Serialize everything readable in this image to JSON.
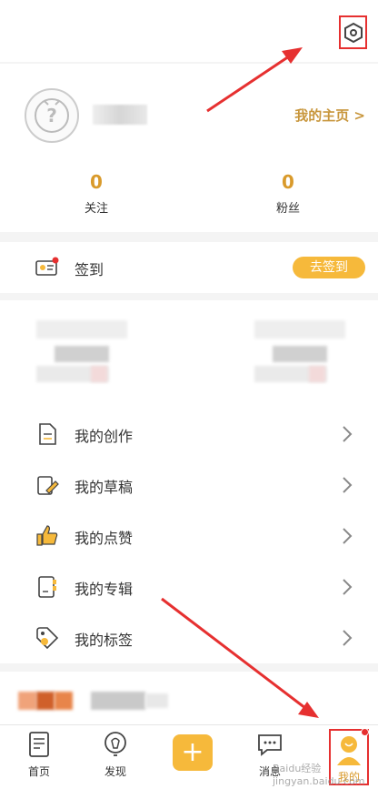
{
  "profile": {
    "home_link": "我的主页 >",
    "follow_count": "0",
    "follow_label": "关注",
    "fans_count": "0",
    "fans_label": "粉丝"
  },
  "signin": {
    "label": "签到",
    "button": "去签到"
  },
  "menu": {
    "items": [
      {
        "label": "我的创作",
        "icon": "document-icon"
      },
      {
        "label": "我的草稿",
        "icon": "draft-icon"
      },
      {
        "label": "我的点赞",
        "icon": "thumbs-up-icon"
      },
      {
        "label": "我的专辑",
        "icon": "album-icon"
      },
      {
        "label": "我的标签",
        "icon": "tag-icon"
      }
    ]
  },
  "tabbar": {
    "home": "首页",
    "discover": "发现",
    "add": "+",
    "messages": "消息",
    "mine": "我的"
  },
  "watermark": "Baidu经验 jingyan.baidu.com",
  "colors": {
    "accent": "#f6b93b",
    "accent_text": "#c8963c",
    "annotation": "#e63030"
  }
}
